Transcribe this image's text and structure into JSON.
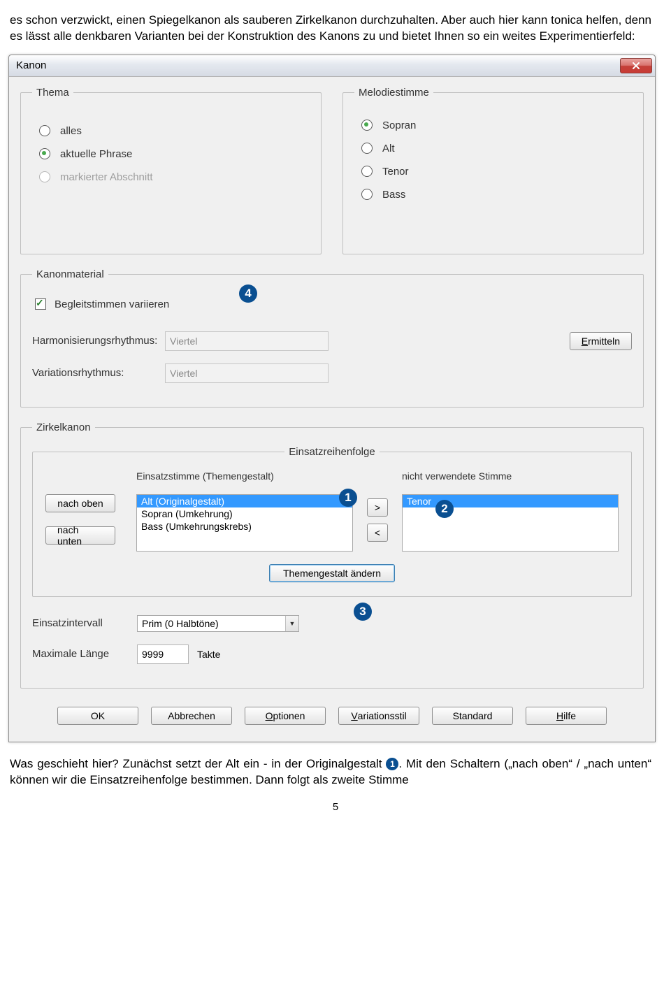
{
  "intro_text": "es schon verzwickt, einen Spiegelkanon als sauberen Zirkelkanon durchzuhalten. Aber auch hier kann tonica helfen, denn es lässt alle denkbaren Varianten bei der Konstruktion des Kanons zu und bietet Ihnen so ein weites Experimentierfeld:",
  "dialog": {
    "title": "Kanon",
    "close": "×",
    "thema": {
      "legend": "Thema",
      "options": {
        "alles": "alles",
        "aktuelle_phrase": "aktuelle Phrase",
        "markierter": "markierter Abschnitt"
      }
    },
    "melodiestimme": {
      "legend": "Melodiestimme",
      "options": {
        "sopran": "Sopran",
        "alt": "Alt",
        "tenor": "Tenor",
        "bass": "Bass"
      }
    },
    "kanonmaterial": {
      "legend": "Kanonmaterial",
      "begleit_label": "Begleitstimmen variieren",
      "harm_label": "Harmonisierungsrhythmus:",
      "harm_value": "Viertel",
      "var_label": "Variationsrhythmus:",
      "var_value": "Viertel",
      "ermitteln": "Ermitteln"
    },
    "zirkel": {
      "legend": "Zirkelkanon",
      "einsatz_legend": "Einsatzreihenfolge",
      "col1": "Einsatzstimme (Themengestalt)",
      "col2": "nicht verwendete Stimme",
      "list1": [
        "Alt (Originalgestalt)",
        "Sopran (Umkehrung)",
        "Bass (Umkehrungskrebs)"
      ],
      "list2": [
        "Tenor"
      ],
      "nach_oben": "nach oben",
      "nach_unten": "nach unten",
      "themengestalt": "Themengestalt ändern",
      "einsatzintervall_label": "Einsatzintervall",
      "einsatzintervall_value": "Prim (0 Halbtöne)",
      "maxlen_label": "Maximale Länge",
      "maxlen_value": "9999",
      "maxlen_unit": "Takte"
    },
    "buttons": {
      "ok": "OK",
      "abbrechen": "Abbrechen",
      "optionen": "Optionen",
      "variationsstil": "Variationsstil",
      "standard": "Standard",
      "hilfe": "Hilfe"
    }
  },
  "markers": {
    "m1": "1",
    "m2": "2",
    "m3": "3",
    "m4": "4"
  },
  "outro": {
    "line1_a": "Was geschieht hier? Zunächst setzt der Alt ein - in der Originalgestalt ",
    "line1_b": ". Mit den Schaltern („nach",
    "line2": "oben“ / „nach unten“ können wir die Einsatzreihenfolge bestimmen. Dann folgt als zweite Stimme"
  },
  "page_number": "5"
}
